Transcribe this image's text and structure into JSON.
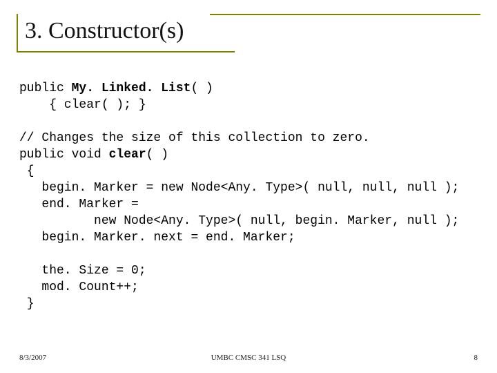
{
  "title": "3. Constructor(s)",
  "code": {
    "l1a": "public ",
    "l1b": "My. Linked. List",
    "l1c": "( )",
    "l2": "    { clear( ); }",
    "l3": "",
    "l4": "// Changes the size of this collection to zero.",
    "l5a": "public void ",
    "l5b": "clear",
    "l5c": "( )",
    "l6": " {",
    "l7": "   begin. Marker = new Node<Any. Type>( null, null, null );",
    "l8": "   end. Marker =",
    "l9": "          new Node<Any. Type>( null, begin. Marker, null );",
    "l10": "   begin. Marker. next = end. Marker;",
    "l11": "",
    "l12": "   the. Size = 0;",
    "l13": "   mod. Count++;",
    "l14": " }"
  },
  "footer": {
    "date": "8/3/2007",
    "center": "UMBC CMSC 341 LSQ",
    "page": "8"
  }
}
